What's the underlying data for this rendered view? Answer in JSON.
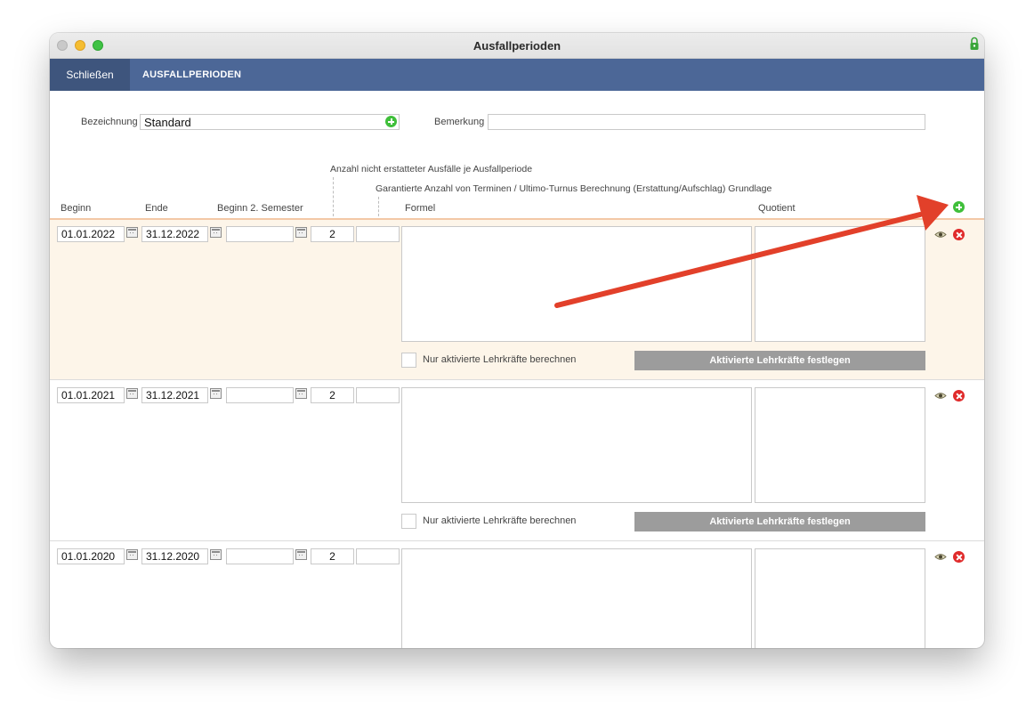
{
  "window": {
    "title": "Ausfallperioden"
  },
  "toolbar": {
    "close_label": "Schließen",
    "title": "AUSFALLPERIODEN"
  },
  "form": {
    "bezeichnung_label": "Bezeichnung",
    "bezeichnung_value": "Standard",
    "bemerkung_label": "Bemerkung",
    "bemerkung_value": ""
  },
  "headers": {
    "anzahl_nicht_erstattet": "Anzahl nicht erstatteter Ausfälle je Ausfallperiode",
    "garantierte_anzahl": "Garantierte Anzahl von Terminen / Ultimo-Turnus Berechnung (Erstattung/Aufschlag) Grundlage",
    "beginn": "Beginn",
    "ende": "Ende",
    "beginn_semester": "Beginn 2. Semester",
    "formel": "Formel",
    "quotient": "Quotient"
  },
  "rows": [
    {
      "beginn": "01.01.2022",
      "ende": "31.12.2022",
      "semester": "",
      "anzahl": "2",
      "garantiert": "",
      "checkbox_label": "Nur aktivierte Lehrkräfte berechnen",
      "button_label": "Aktivierte Lehrkräfte festlegen"
    },
    {
      "beginn": "01.01.2021",
      "ende": "31.12.2021",
      "semester": "",
      "anzahl": "2",
      "garantiert": "",
      "checkbox_label": "Nur aktivierte Lehrkräfte berechnen",
      "button_label": "Aktivierte Lehrkräfte festlegen"
    },
    {
      "beginn": "01.01.2020",
      "ende": "31.12.2020",
      "semester": "",
      "anzahl": "2",
      "garantiert": ""
    }
  ],
  "colors": {
    "toolbar": "#4c6797",
    "toolbar_close": "#3e557d",
    "highlight_row": "#fdf5e9",
    "arrow": "#e2402a",
    "add_icon": "#3fbf3a",
    "delete_icon": "#e02b2b",
    "button_gray": "#9c9c9c"
  },
  "icons": [
    "lock-icon",
    "add-icon",
    "calendar-icon",
    "eye-icon",
    "delete-icon"
  ]
}
